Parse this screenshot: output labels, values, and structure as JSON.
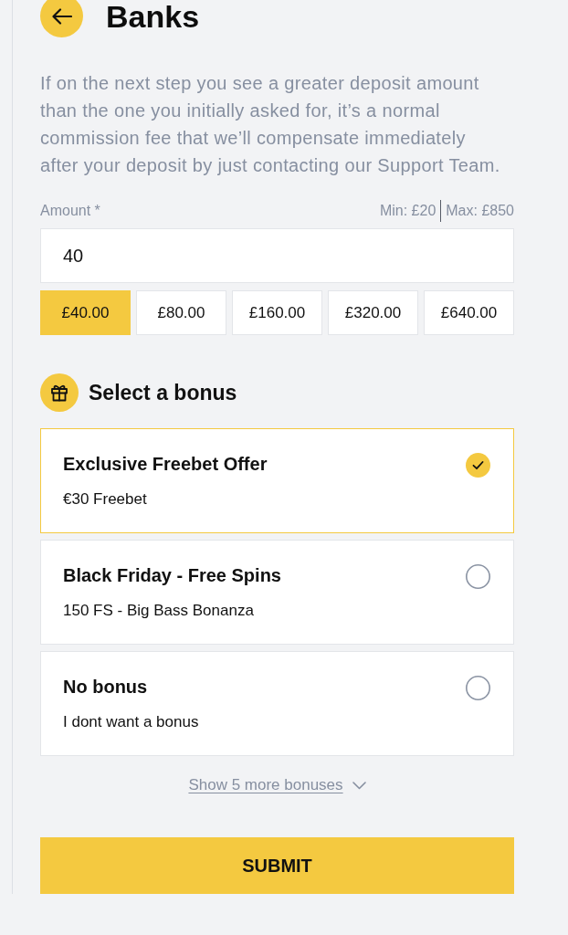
{
  "header": {
    "title": "Banks"
  },
  "notice": "If on the next step you see a greater deposit amount than the one you initially asked for, it’s a normal commission fee that we’ll compensate immediately after your deposit by just contacting our Support Team.",
  "amount": {
    "label": "Amount *",
    "min": "Min: £20",
    "max": "Max: £850",
    "value": "40",
    "presets": [
      {
        "label": "£40.00",
        "selected": true
      },
      {
        "label": "£80.00",
        "selected": false
      },
      {
        "label": "£160.00",
        "selected": false
      },
      {
        "label": "£320.00",
        "selected": false
      },
      {
        "label": "£640.00",
        "selected": false
      }
    ]
  },
  "bonus_section": {
    "title": "Select a bonus",
    "bonuses": [
      {
        "title": "Exclusive Freebet Offer",
        "description": "€30 Freebet",
        "selected": true
      },
      {
        "title": "Black Friday - Free Spins",
        "description": "150 FS - Big Bass Bonanza",
        "selected": false
      },
      {
        "title": "No bonus",
        "description": "I dont want a bonus",
        "selected": false
      }
    ],
    "show_more": "Show 5 more bonuses"
  },
  "submit": "SUBMIT"
}
